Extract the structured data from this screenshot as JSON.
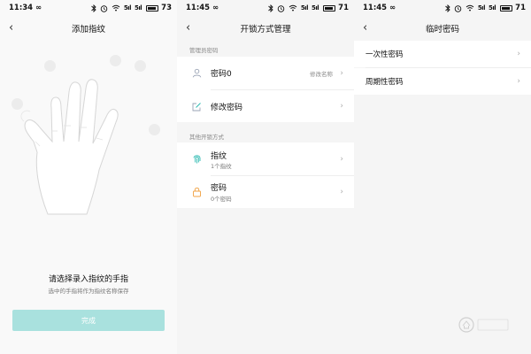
{
  "screens": [
    {
      "status": {
        "time": "11:34",
        "battery": "73"
      },
      "title": "添加指纹",
      "prompt": "请选择录入指纹的手指",
      "subprompt": "选中的手指将作为指纹名称保存",
      "done_label": "完成"
    },
    {
      "status": {
        "time": "11:45",
        "battery": "71"
      },
      "title": "开锁方式管理",
      "admin_section_label": "管理员密码",
      "admin_rows": [
        {
          "label": "密码0",
          "action": "修改名称",
          "icon": "user-icon"
        },
        {
          "label": "修改密码",
          "icon": "edit-icon"
        }
      ],
      "other_section_label": "其他开锁方式",
      "other_rows": [
        {
          "label": "指纹",
          "sub": "1个指纹",
          "icon": "fingerprint-icon"
        },
        {
          "label": "密码",
          "sub": "0个密码",
          "icon": "lock-icon"
        }
      ]
    },
    {
      "status": {
        "time": "11:45",
        "battery": "71"
      },
      "title": "临时密码",
      "rows": [
        {
          "label": "一次性密码"
        },
        {
          "label": "周期性密码"
        }
      ]
    }
  ],
  "status_glyphs": {
    "infinity": "∞",
    "signal": "5ıl"
  },
  "colors": {
    "accent": "#2bb9b0",
    "button_disabled": "#a9e1de",
    "icon_orange": "#f0a040"
  }
}
